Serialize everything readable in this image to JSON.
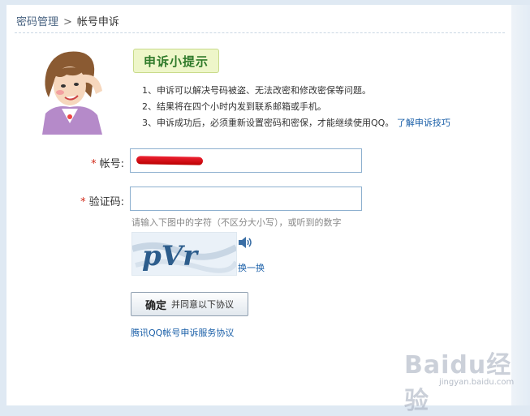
{
  "breadcrumb": {
    "parent": "密码管理",
    "separator": ">",
    "current": "帐号申诉"
  },
  "tips": {
    "title": "申诉小提示",
    "items": [
      "1、申诉可以解决号码被盗、无法改密和修改密保等问题。",
      "2、结果将在四个小时内发到联系邮箱或手机。",
      "3、申诉成功后，必须重新设置密码和密保，才能继续使用QQ。"
    ],
    "link": "了解申诉技巧"
  },
  "form": {
    "required_mark": "*",
    "account_label": "帐号:",
    "account_value": "",
    "captcha_label": "验证码:",
    "captcha_value": "",
    "captcha_hint": "请输入下图中的字符（不区分大小写），或听到的数字",
    "captcha_text": "pVr",
    "refresh_label": "换一换"
  },
  "submit": {
    "label": "确定",
    "sublabel": "并同意以下协议"
  },
  "agreement": "腾讯QQ帐号申诉服务协议",
  "watermark": {
    "text": "Baidu经验",
    "url": "jingyan.baidu.com"
  },
  "colors": {
    "link": "#1a5fa8",
    "required": "#d12a1a",
    "tip_title": "#2f7a2a"
  }
}
